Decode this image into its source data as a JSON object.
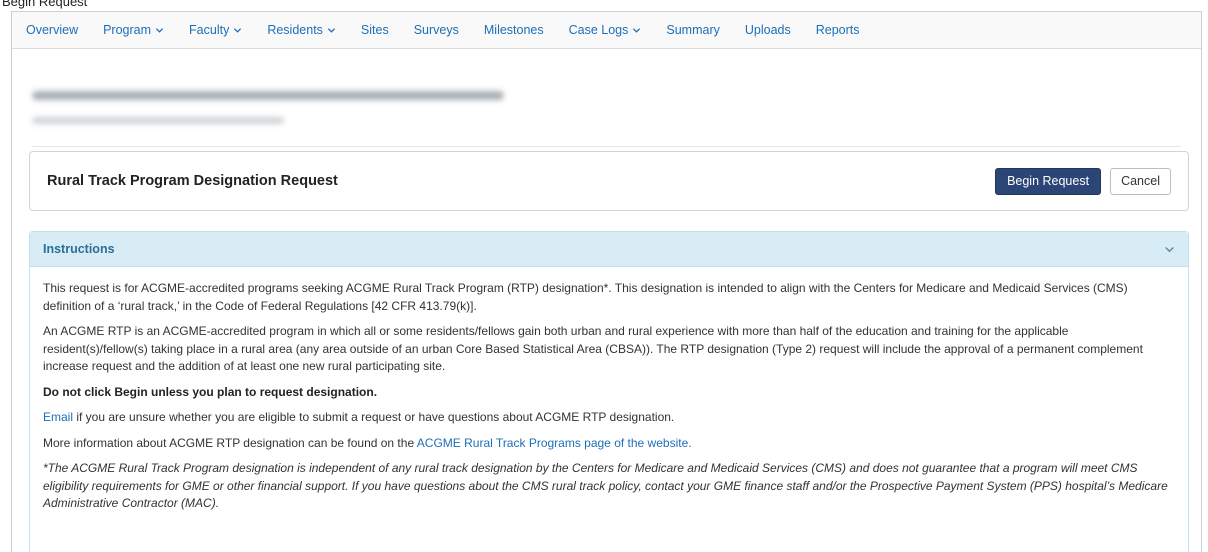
{
  "caption": "Begin Request",
  "nav": {
    "items": [
      {
        "label": "Overview",
        "dropdown": false
      },
      {
        "label": "Program",
        "dropdown": true
      },
      {
        "label": "Faculty",
        "dropdown": true
      },
      {
        "label": "Residents",
        "dropdown": true
      },
      {
        "label": "Sites",
        "dropdown": false
      },
      {
        "label": "Surveys",
        "dropdown": false
      },
      {
        "label": "Milestones",
        "dropdown": false
      },
      {
        "label": "Case Logs",
        "dropdown": true
      },
      {
        "label": "Summary",
        "dropdown": false
      },
      {
        "label": "Uploads",
        "dropdown": false
      },
      {
        "label": "Reports",
        "dropdown": false
      }
    ]
  },
  "request": {
    "title": "Rural Track Program Designation Request",
    "begin_label": "Begin Request",
    "cancel_label": "Cancel"
  },
  "instructions": {
    "heading": "Instructions",
    "p1": "This request is for ACGME-accredited programs seeking ACGME Rural Track Program (RTP) designation*. This designation is intended to align with the Centers for Medicare and Medicaid Services (CMS) definition of a ‘rural track,’ in the Code of Federal Regulations [42 CFR 413.79(k)].",
    "p2": "An ACGME RTP is an ACGME-accredited program in which all or some residents/fellows gain both urban and rural experience with more than half of the education and training for the applicable resident(s)/fellow(s) taking place in a rural area (any area outside of an urban Core Based Statistical Area (CBSA)). The RTP designation (Type 2) request will include the approval of a permanent complement increase request and the addition of at least one new rural participating site.",
    "warning": "Do not click Begin unless you plan to request designation.",
    "email_link": "Email",
    "email_text": " if you are unsure whether you are eligible to submit a request or have questions about ACGME RTP designation.",
    "more_text": "More information about ACGME RTP designation can be found on the ",
    "more_link": "ACGME Rural Track Programs page of the website.",
    "footnote": "*The ACGME Rural Track Program designation is independent of any rural track designation by the Centers for Medicare and Medicaid Services (CMS) and does not guarantee that a program will meet CMS eligibility requirements for GME or other financial support. If you have questions about the CMS rural track policy, contact your GME finance staff and/or the Prospective Payment System (PPS) hospital’s Medicare Administrative Contractor (MAC)."
  },
  "colors": {
    "link": "#1c6fb8",
    "primary_button": "#2a4576",
    "panel_header": "#d8ecf5"
  }
}
